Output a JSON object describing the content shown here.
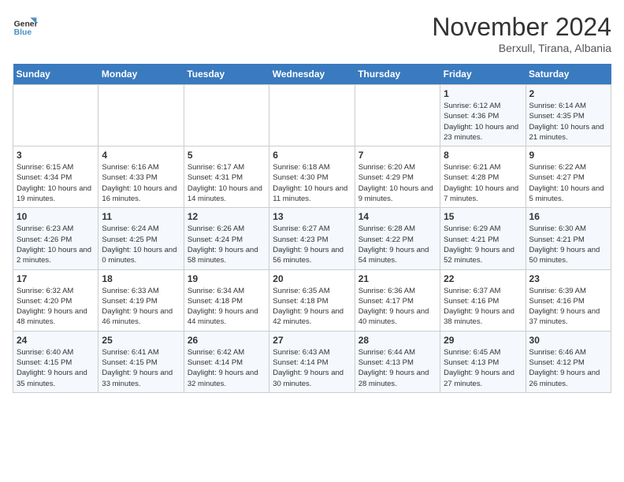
{
  "logo": {
    "line1": "General",
    "line2": "Blue"
  },
  "title": "November 2024",
  "subtitle": "Berxull, Tirana, Albania",
  "days_header": [
    "Sunday",
    "Monday",
    "Tuesday",
    "Wednesday",
    "Thursday",
    "Friday",
    "Saturday"
  ],
  "weeks": [
    [
      {
        "num": "",
        "info": ""
      },
      {
        "num": "",
        "info": ""
      },
      {
        "num": "",
        "info": ""
      },
      {
        "num": "",
        "info": ""
      },
      {
        "num": "",
        "info": ""
      },
      {
        "num": "1",
        "info": "Sunrise: 6:12 AM\nSunset: 4:36 PM\nDaylight: 10 hours and 23 minutes."
      },
      {
        "num": "2",
        "info": "Sunrise: 6:14 AM\nSunset: 4:35 PM\nDaylight: 10 hours and 21 minutes."
      }
    ],
    [
      {
        "num": "3",
        "info": "Sunrise: 6:15 AM\nSunset: 4:34 PM\nDaylight: 10 hours and 19 minutes."
      },
      {
        "num": "4",
        "info": "Sunrise: 6:16 AM\nSunset: 4:33 PM\nDaylight: 10 hours and 16 minutes."
      },
      {
        "num": "5",
        "info": "Sunrise: 6:17 AM\nSunset: 4:31 PM\nDaylight: 10 hours and 14 minutes."
      },
      {
        "num": "6",
        "info": "Sunrise: 6:18 AM\nSunset: 4:30 PM\nDaylight: 10 hours and 11 minutes."
      },
      {
        "num": "7",
        "info": "Sunrise: 6:20 AM\nSunset: 4:29 PM\nDaylight: 10 hours and 9 minutes."
      },
      {
        "num": "8",
        "info": "Sunrise: 6:21 AM\nSunset: 4:28 PM\nDaylight: 10 hours and 7 minutes."
      },
      {
        "num": "9",
        "info": "Sunrise: 6:22 AM\nSunset: 4:27 PM\nDaylight: 10 hours and 5 minutes."
      }
    ],
    [
      {
        "num": "10",
        "info": "Sunrise: 6:23 AM\nSunset: 4:26 PM\nDaylight: 10 hours and 2 minutes."
      },
      {
        "num": "11",
        "info": "Sunrise: 6:24 AM\nSunset: 4:25 PM\nDaylight: 10 hours and 0 minutes."
      },
      {
        "num": "12",
        "info": "Sunrise: 6:26 AM\nSunset: 4:24 PM\nDaylight: 9 hours and 58 minutes."
      },
      {
        "num": "13",
        "info": "Sunrise: 6:27 AM\nSunset: 4:23 PM\nDaylight: 9 hours and 56 minutes."
      },
      {
        "num": "14",
        "info": "Sunrise: 6:28 AM\nSunset: 4:22 PM\nDaylight: 9 hours and 54 minutes."
      },
      {
        "num": "15",
        "info": "Sunrise: 6:29 AM\nSunset: 4:21 PM\nDaylight: 9 hours and 52 minutes."
      },
      {
        "num": "16",
        "info": "Sunrise: 6:30 AM\nSunset: 4:21 PM\nDaylight: 9 hours and 50 minutes."
      }
    ],
    [
      {
        "num": "17",
        "info": "Sunrise: 6:32 AM\nSunset: 4:20 PM\nDaylight: 9 hours and 48 minutes."
      },
      {
        "num": "18",
        "info": "Sunrise: 6:33 AM\nSunset: 4:19 PM\nDaylight: 9 hours and 46 minutes."
      },
      {
        "num": "19",
        "info": "Sunrise: 6:34 AM\nSunset: 4:18 PM\nDaylight: 9 hours and 44 minutes."
      },
      {
        "num": "20",
        "info": "Sunrise: 6:35 AM\nSunset: 4:18 PM\nDaylight: 9 hours and 42 minutes."
      },
      {
        "num": "21",
        "info": "Sunrise: 6:36 AM\nSunset: 4:17 PM\nDaylight: 9 hours and 40 minutes."
      },
      {
        "num": "22",
        "info": "Sunrise: 6:37 AM\nSunset: 4:16 PM\nDaylight: 9 hours and 38 minutes."
      },
      {
        "num": "23",
        "info": "Sunrise: 6:39 AM\nSunset: 4:16 PM\nDaylight: 9 hours and 37 minutes."
      }
    ],
    [
      {
        "num": "24",
        "info": "Sunrise: 6:40 AM\nSunset: 4:15 PM\nDaylight: 9 hours and 35 minutes."
      },
      {
        "num": "25",
        "info": "Sunrise: 6:41 AM\nSunset: 4:15 PM\nDaylight: 9 hours and 33 minutes."
      },
      {
        "num": "26",
        "info": "Sunrise: 6:42 AM\nSunset: 4:14 PM\nDaylight: 9 hours and 32 minutes."
      },
      {
        "num": "27",
        "info": "Sunrise: 6:43 AM\nSunset: 4:14 PM\nDaylight: 9 hours and 30 minutes."
      },
      {
        "num": "28",
        "info": "Sunrise: 6:44 AM\nSunset: 4:13 PM\nDaylight: 9 hours and 28 minutes."
      },
      {
        "num": "29",
        "info": "Sunrise: 6:45 AM\nSunset: 4:13 PM\nDaylight: 9 hours and 27 minutes."
      },
      {
        "num": "30",
        "info": "Sunrise: 6:46 AM\nSunset: 4:12 PM\nDaylight: 9 hours and 26 minutes."
      }
    ]
  ]
}
